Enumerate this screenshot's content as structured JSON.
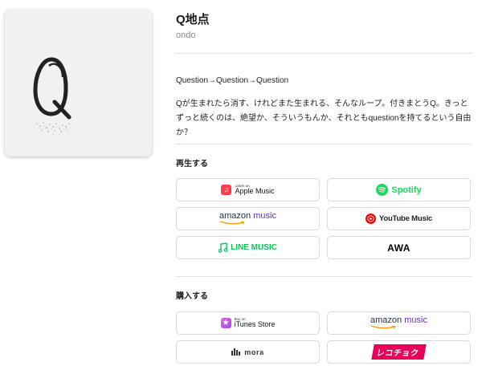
{
  "song": {
    "title": "Q地点",
    "artist": "ondo",
    "subtitle": "Question→Question→Question",
    "description": "Qが生まれたら消す、けれどまた生まれる、そんなループ。付きまとうQ。きっとずっと続くのは、絶望か、そういうもんか、それともquestionを持てるという自由か？",
    "artwork_letter": "Q"
  },
  "play": {
    "label": "再生する",
    "services": [
      {
        "name": "Apple Music",
        "small": "Listen on",
        "icon": "apple-music-icon",
        "color": "#fa3c4c"
      },
      {
        "name": "Spotify",
        "icon": "spotify-icon",
        "color": "#1ed760"
      },
      {
        "name": "amazon",
        "name2": "music",
        "icon": "amazon-smile-icon",
        "color": "#6b2bd6"
      },
      {
        "name": "YouTube Music",
        "icon": "youtube-music-icon",
        "color": "#ff0000"
      },
      {
        "name": "LINE MUSIC",
        "icon": "line-music-icon",
        "color": "#06c755"
      },
      {
        "name": "AWA",
        "icon": "awa-logo",
        "color": "#000000"
      }
    ]
  },
  "buy": {
    "label": "購入する",
    "services": [
      {
        "name": "iTunes Store",
        "small": "Buy on",
        "icon": "itunes-star-icon",
        "color": "#d340e8"
      },
      {
        "name": "amazon",
        "name2": "music",
        "icon": "amazon-smile-icon",
        "color": "#6b2bd6"
      },
      {
        "name": "mora",
        "icon": "mora-icon",
        "color": "#333333"
      },
      {
        "name": "レコチョク",
        "icon": "recochoku-logo",
        "color": "#e6005a"
      }
    ]
  }
}
